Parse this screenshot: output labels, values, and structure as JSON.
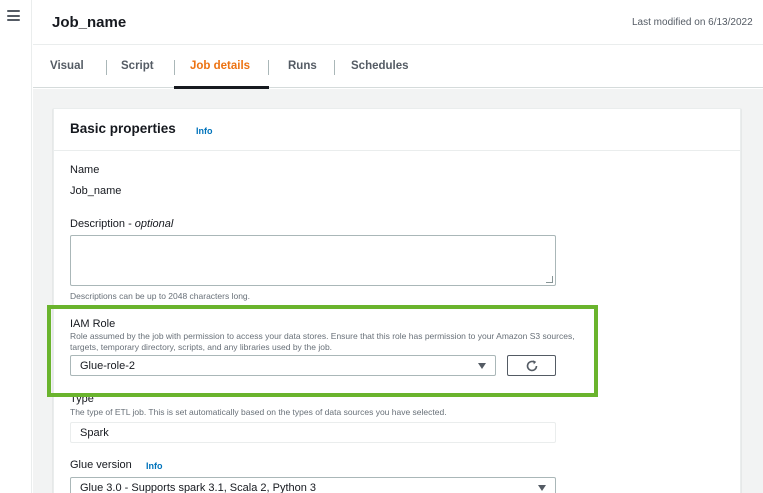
{
  "header": {
    "job_title": "Job_name",
    "last_modified": "Last modified on 6/13/2022"
  },
  "tabs": [
    {
      "label": "Visual",
      "active": false
    },
    {
      "label": "Script",
      "active": false
    },
    {
      "label": "Job details",
      "active": true
    },
    {
      "label": "Runs",
      "active": false
    },
    {
      "label": "Schedules",
      "active": false
    }
  ],
  "basic_properties": {
    "title": "Basic properties",
    "info": "Info",
    "name_label": "Name",
    "name_value": "Job_name",
    "description_label": "Description - ",
    "description_optional": "optional",
    "description_value": "",
    "description_hint": "Descriptions can be up to 2048 characters long.",
    "iam_label": "IAM Role",
    "iam_hint_line1": "Role assumed by the job with permission to access your data stores. Ensure that this role has permission to your Amazon S3 sources,",
    "iam_hint_line2": "targets, temporary directory, scripts, and any libraries used by the job.",
    "iam_value": "Glue-role-2",
    "type_label": "Type",
    "type_hint": "The type of ETL job. This is set automatically based on the types of data sources you have selected.",
    "type_value": "Spark",
    "glue_version_label": "Glue version",
    "glue_version_info": "Info",
    "glue_version_value": "Glue 3.0 - Supports spark 3.1, Scala 2, Python 3"
  },
  "icons": {
    "menu": "hamburger-menu-icon",
    "refresh": "refresh-icon",
    "dropdown": "chevron-down-icon"
  },
  "colors": {
    "active_tab": "#ec7211",
    "info_link": "#0073bb",
    "highlight": "#6ab42d"
  }
}
